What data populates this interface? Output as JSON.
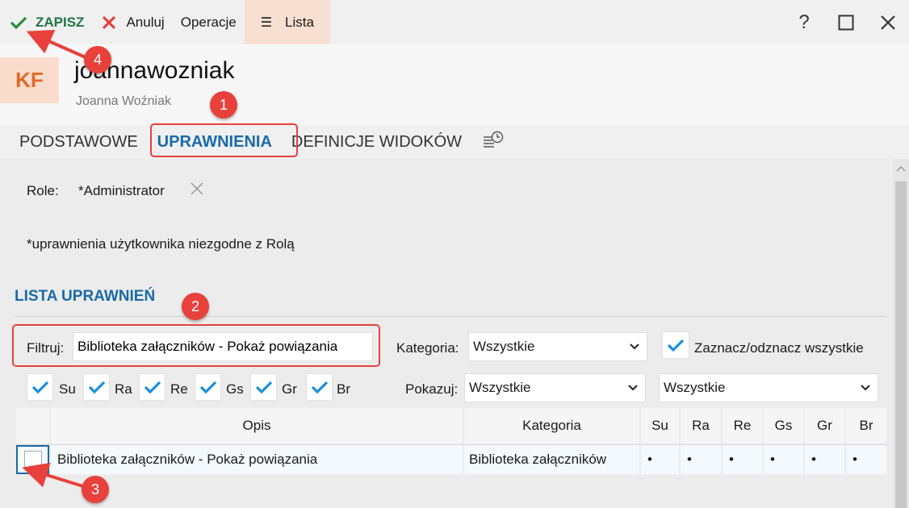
{
  "toolbar": {
    "save_label": "ZAPISZ",
    "cancel_label": "Anuluj",
    "operations_label": "Operacje",
    "list_label": "Lista",
    "help_label": "?"
  },
  "header": {
    "avatar_initials": "KF",
    "login": "joannawozniak",
    "full_name": "Joanna Woźniak"
  },
  "tabs": [
    {
      "label": "PODSTAWOWE"
    },
    {
      "label": "UPRAWNIENIA",
      "active": true
    },
    {
      "label": "DEFINICJE WIDOKÓW"
    }
  ],
  "roles": {
    "label": "Role:",
    "value": "*Administrator",
    "note": "*uprawnienia użytkownika niezgodne z Rolą"
  },
  "permissions": {
    "section_title": "LISTA UPRAWNIEŃ",
    "filter_label": "Filtruj:",
    "filter_value": "Biblioteka załączników - Pokaż powiązania",
    "category_label": "Kategoria:",
    "category_value": "Wszystkie",
    "select_all_label": "Zaznacz/odznacz wszystkie",
    "show_label": "Pokazuj:",
    "show_value": "Wszystkie",
    "show_value_2": "Wszystkie",
    "flags": [
      "Su",
      "Ra",
      "Re",
      "Gs",
      "Gr",
      "Br"
    ]
  },
  "table": {
    "columns": [
      "Opis",
      "Kategoria",
      "Su",
      "Ra",
      "Re",
      "Gs",
      "Gr",
      "Br"
    ],
    "rows": [
      {
        "opis": "Biblioteka załączników - Pokaż powiązania",
        "kategoria": "Biblioteka załączników",
        "su": "•",
        "ra": "•",
        "re": "•",
        "gs": "•",
        "gr": "•",
        "br": "•"
      }
    ]
  },
  "annotations": [
    "1",
    "2",
    "3",
    "4"
  ],
  "colors": {
    "accent": "#1a6aa8",
    "save": "#217346",
    "annotation": "#e8413c",
    "list_bg": "#f7dfd2"
  }
}
